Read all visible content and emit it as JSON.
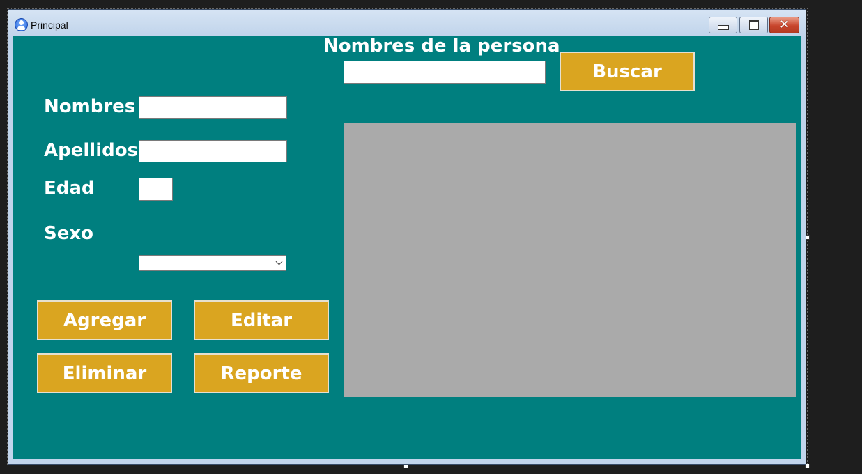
{
  "window": {
    "title": "Principal",
    "close_glyph": "✕"
  },
  "search": {
    "label": "Nombres de la persona",
    "value": "",
    "button_label": "Buscar"
  },
  "form": {
    "nombres_label": "Nombres",
    "nombres_value": "",
    "apellidos_label": "Apellidos",
    "apellidos_value": "",
    "edad_label": "Edad",
    "edad_value": "",
    "sexo_label": "Sexo",
    "sexo_selected": ""
  },
  "actions": {
    "agregar": "Agregar",
    "editar": "Editar",
    "eliminar": "Eliminar",
    "reporte": "Reporte"
  },
  "colors": {
    "client_background": "#007f7f",
    "button_background": "#daa520",
    "grid_background": "#aaaaaa"
  }
}
